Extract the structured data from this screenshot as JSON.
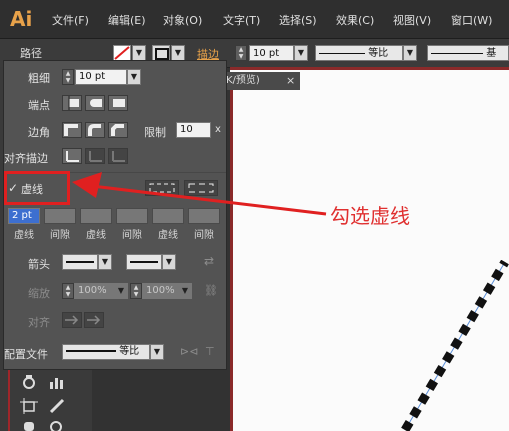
{
  "app": {
    "logo": "Ai"
  },
  "menu": [
    "文件(F)",
    "编辑(E)",
    "对象(O)",
    "文字(T)",
    "选择(S)",
    "效果(C)",
    "视图(V)",
    "窗口(W)"
  ],
  "toolbar": {
    "path_label": "路径",
    "stroke_label": "描边",
    "stroke_value": "10 pt",
    "profile_label": "等比",
    "brush_label": "基"
  },
  "document_tab": {
    "title": "K/预览)",
    "close": "×"
  },
  "stroke_panel": {
    "weight_label": "粗细",
    "weight_value": "10 pt",
    "cap_label": "端点",
    "corner_label": "边角",
    "limit_label": "限制",
    "limit_value": "10",
    "limit_unit": "x",
    "align_label": "对齐描边",
    "dashed_label": "虚线",
    "dashed_checked": true,
    "check_mark": "✓",
    "dash_fields": [
      "2 pt",
      "",
      "",
      "",
      "",
      ""
    ],
    "dash_labels": [
      "虚线",
      "间隙",
      "虚线",
      "间隙",
      "虚线",
      "间隙"
    ],
    "arrow_label": "箭头",
    "scale_label": "缩放",
    "scale_start": "100%",
    "scale_end": "100%",
    "arrow_align_label": "对齐",
    "profile_label": "配置文件",
    "profile_value": "等比"
  },
  "annotation": {
    "text": "勾选虚线",
    "color": "#e03030"
  },
  "colors": {
    "accent_red": "#e02020",
    "dash_color": "#111111",
    "selection_blue": "#3d6fd0",
    "logo_orange": "#e8a24a"
  }
}
